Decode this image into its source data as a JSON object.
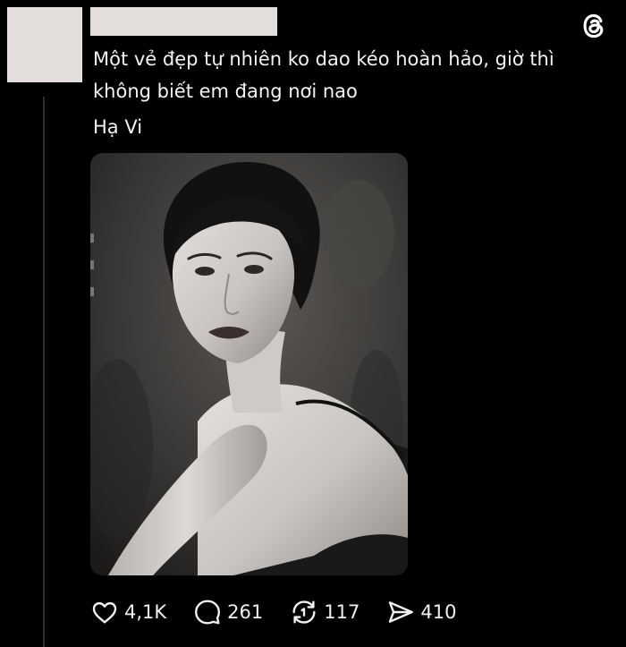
{
  "post": {
    "caption_line1": "Một vẻ đẹp tự nhiên ko dao kéo hoàn hảo, giờ thì",
    "caption_line2": "không biết em đang nơi nao",
    "name_line": "Hạ Vi",
    "image_alt": "Black and white portrait of a woman"
  },
  "actions": {
    "likes": "4,1K",
    "replies": "261",
    "reposts": "117",
    "shares": "410"
  },
  "icons": {
    "brand": "threads-logo-icon",
    "like": "heart-icon",
    "reply": "speech-bubble-icon",
    "repost": "repost-icon",
    "share": "send-icon"
  },
  "colors": {
    "background": "#000000",
    "text": "#f3f3f3",
    "redaction": "#e3dddc",
    "thread_line": "#2e2e2e"
  }
}
